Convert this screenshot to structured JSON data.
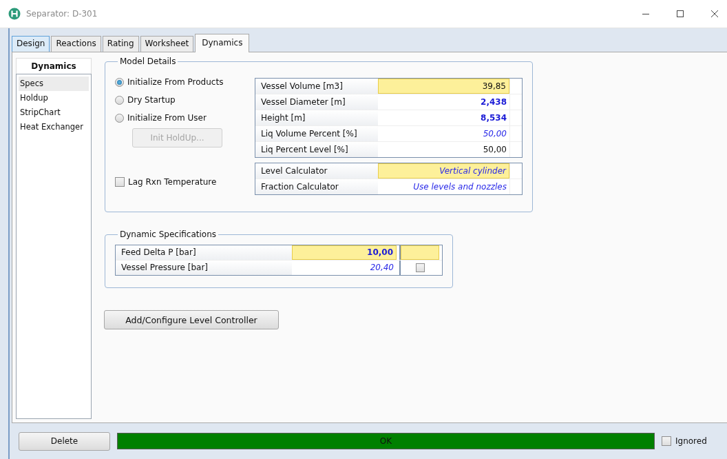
{
  "window": {
    "title": "Separator: D-301"
  },
  "tabs": [
    {
      "label": "Design",
      "selected": false
    },
    {
      "label": "Reactions",
      "selected": false
    },
    {
      "label": "Rating",
      "selected": false
    },
    {
      "label": "Worksheet",
      "selected": false
    },
    {
      "label": "Dynamics",
      "selected": true
    }
  ],
  "sidebar": {
    "title": "Dynamics",
    "items": [
      {
        "label": "Specs",
        "selected": true
      },
      {
        "label": "Holdup",
        "selected": false
      },
      {
        "label": "StripChart",
        "selected": false
      },
      {
        "label": "Heat Exchanger",
        "selected": false
      }
    ]
  },
  "model_details": {
    "title": "Model Details",
    "init_options": [
      {
        "label": "Initialize From Products",
        "selected": true
      },
      {
        "label": "Dry Startup",
        "selected": false
      },
      {
        "label": "Initialize From User",
        "selected": false
      }
    ],
    "init_button": {
      "label": "Init HoldUp...",
      "disabled": true
    },
    "lag_checkbox": {
      "label": "Lag Rxn Temperature",
      "checked": false
    },
    "vessel_table": [
      {
        "label": "Vessel Volume [m3]",
        "value": "39,85",
        "kind": "calculated",
        "highlight": true
      },
      {
        "label": "Vessel Diameter [m]",
        "value": "2,438",
        "kind": "user",
        "highlight": false
      },
      {
        "label": "Height [m]",
        "value": "8,534",
        "kind": "user",
        "highlight": false
      },
      {
        "label": "Liq Volume Percent [%]",
        "value": "50,00",
        "kind": "default",
        "highlight": false
      },
      {
        "label": "Liq Percent Level [%]",
        "value": "50,00",
        "kind": "calculated",
        "highlight": false
      }
    ],
    "calculator_table": [
      {
        "label": "Level Calculator",
        "value": "Vertical cylinder",
        "kind": "default",
        "highlight": true
      },
      {
        "label": "Fraction Calculator",
        "value": "Use levels and nozzles",
        "kind": "default",
        "highlight": false
      }
    ]
  },
  "dynamic_specifications": {
    "title": "Dynamic Specifications",
    "rows": [
      {
        "label": "Feed Delta P [bar]",
        "value": "10,00",
        "kind": "user",
        "highlight": true,
        "flag": {
          "kind": "empty",
          "highlight": true
        }
      },
      {
        "label": "Vessel Pressure [bar]",
        "value": "20,40",
        "kind": "default",
        "highlight": false,
        "flag": {
          "kind": "checkbox",
          "checked": false,
          "highlight": false
        }
      }
    ]
  },
  "level_controller_button": {
    "label": "Add/Configure Level Controller"
  },
  "footer": {
    "delete_button": "Delete",
    "status": "OK",
    "ignored": {
      "label": "Ignored",
      "checked": false
    }
  }
}
